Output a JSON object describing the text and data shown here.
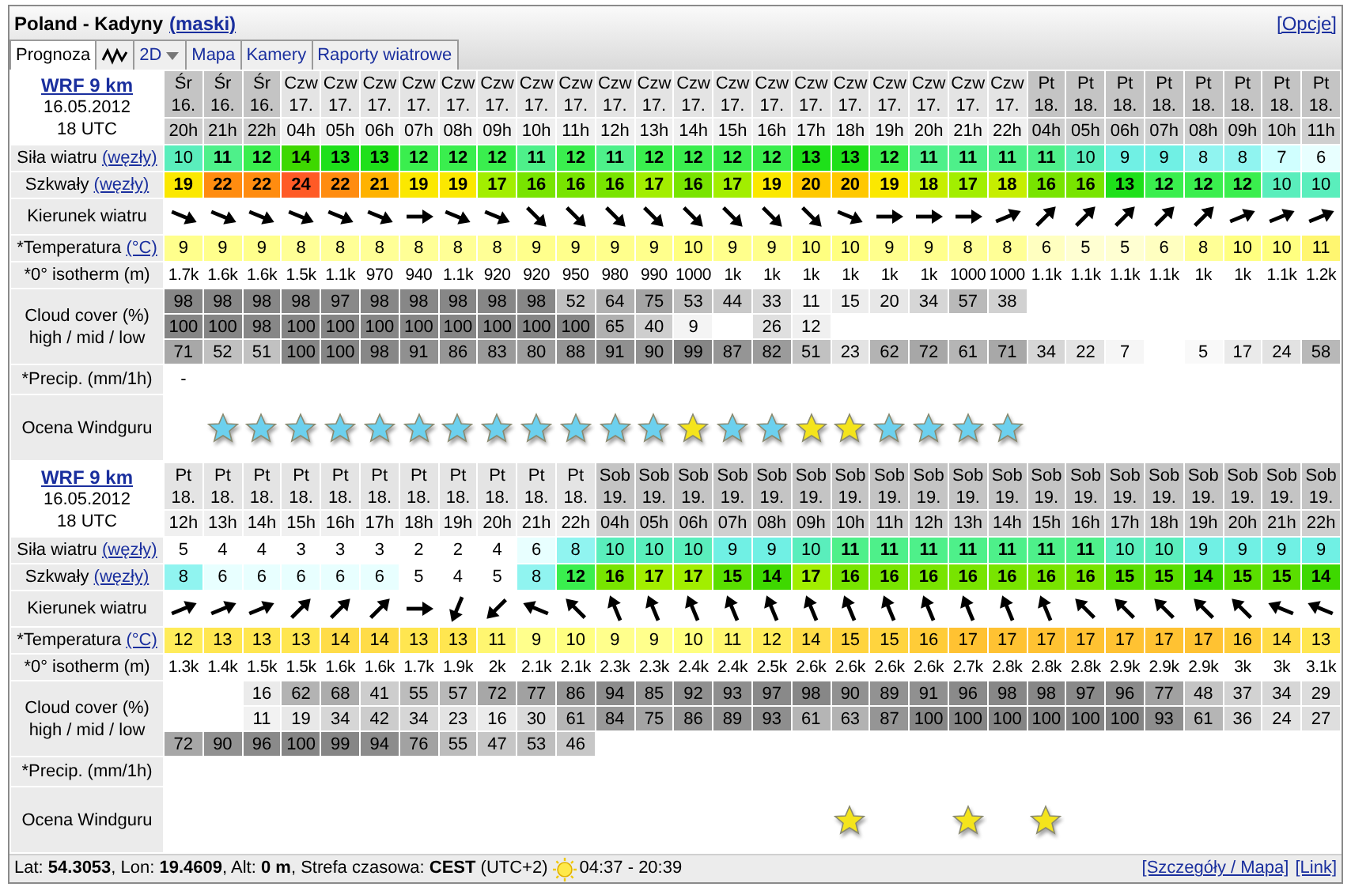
{
  "header": {
    "title": "Poland - Kadyny",
    "masks_link": "(maski)",
    "options_link": "[Opcje]"
  },
  "tabs": [
    {
      "kind": "text",
      "label": "Prognoza",
      "selected": true
    },
    {
      "kind": "graph",
      "selected": false
    },
    {
      "kind": "dropdown",
      "label": "2D",
      "selected": false
    },
    {
      "kind": "text",
      "label": "Mapa",
      "selected": false
    },
    {
      "kind": "text",
      "label": "Kamery",
      "selected": false
    },
    {
      "kind": "text",
      "label": "Raporty wiatrowe",
      "selected": false
    }
  ],
  "tables": [
    {
      "model": "WRF 9 km",
      "date": "16.05.2012",
      "run": "18 UTC",
      "labels": {
        "wind": "Siła wiatru",
        "wind_unit": "(węzły)",
        "gust": "Szkwały",
        "gust_unit": "(węzły)",
        "direction": "Kierunek wiatru",
        "temperature": "*Temperatura",
        "temperature_unit": "(°C)",
        "isotherm": "*0° isotherm (m)",
        "cloud": "Cloud cover (%)",
        "cloud_sub": "high / mid / low",
        "precip": "*Precip. (mm/1h)",
        "rating": "Ocena Windguru"
      },
      "columns": [
        {
          "day": "Śr",
          "date": "16.",
          "hour": "20h",
          "shaded": true,
          "wind": "10",
          "gust": "19",
          "direction": {
            "kind": "ese"
          },
          "temperature": "9",
          "isotherm": "1.7k",
          "cloud_high": "98",
          "cloud_mid": "100",
          "cloud_low": "71",
          "precip": "-"
        },
        {
          "day": "Śr",
          "date": "16.",
          "hour": "21h",
          "shaded": true,
          "wind": "11",
          "gust": "22",
          "direction": {
            "kind": "ese"
          },
          "temperature": "9",
          "isotherm": "1.6k",
          "cloud_high": "98",
          "cloud_mid": "100",
          "cloud_low": "52",
          "color": "#6cd0ee"
        },
        {
          "day": "Śr",
          "date": "16.",
          "hour": "22h",
          "shaded": true,
          "wind": "12",
          "gust": "22",
          "direction": {
            "kind": "ese"
          },
          "temperature": "9",
          "isotherm": "1.6k",
          "cloud_high": "98",
          "cloud_mid": "98",
          "cloud_low": "51",
          "color": "#6cd0ee"
        },
        {
          "day": "Czw",
          "date": "17.",
          "hour": "04h",
          "shaded": false,
          "wind": "14",
          "gust": "24",
          "direction": {
            "kind": "ese"
          },
          "temperature": "8",
          "isotherm": "1.5k",
          "cloud_high": "98",
          "cloud_mid": "100",
          "cloud_low": "100",
          "color": "#6cd0ee"
        },
        {
          "day": "Czw",
          "date": "17.",
          "hour": "05h",
          "shaded": false,
          "wind": "13",
          "gust": "22",
          "direction": {
            "kind": "ese"
          },
          "temperature": "8",
          "isotherm": "1.1k",
          "cloud_high": "97",
          "cloud_mid": "100",
          "cloud_low": "100",
          "color": "#6cd0ee"
        },
        {
          "day": "Czw",
          "date": "17.",
          "hour": "06h",
          "shaded": false,
          "wind": "13",
          "gust": "21",
          "direction": {
            "kind": "ese"
          },
          "temperature": "8",
          "isotherm": "970",
          "cloud_high": "98",
          "cloud_mid": "100",
          "cloud_low": "98",
          "color": "#6cd0ee"
        },
        {
          "day": "Czw",
          "date": "17.",
          "hour": "07h",
          "shaded": false,
          "wind": "12",
          "gust": "19",
          "direction": {
            "kind": "e"
          },
          "temperature": "8",
          "isotherm": "940",
          "cloud_high": "98",
          "cloud_mid": "100",
          "cloud_low": "91",
          "color": "#6cd0ee"
        },
        {
          "day": "Czw",
          "date": "17.",
          "hour": "08h",
          "shaded": false,
          "wind": "12",
          "gust": "19",
          "direction": {
            "kind": "ese"
          },
          "temperature": "8",
          "isotherm": "1.1k",
          "cloud_high": "98",
          "cloud_mid": "100",
          "cloud_low": "86",
          "color": "#6cd0ee"
        },
        {
          "day": "Czw",
          "date": "17.",
          "hour": "09h",
          "shaded": false,
          "wind": "12",
          "gust": "17",
          "direction": {
            "kind": "ese"
          },
          "temperature": "8",
          "isotherm": "920",
          "cloud_high": "98",
          "cloud_mid": "100",
          "cloud_low": "83",
          "color": "#6cd0ee"
        },
        {
          "day": "Czw",
          "date": "17.",
          "hour": "10h",
          "shaded": false,
          "wind": "11",
          "gust": "16",
          "direction": {
            "kind": "se"
          },
          "temperature": "9",
          "isotherm": "920",
          "cloud_high": "98",
          "cloud_mid": "100",
          "cloud_low": "80",
          "color": "#6cd0ee"
        },
        {
          "day": "Czw",
          "date": "17.",
          "hour": "11h",
          "shaded": false,
          "wind": "12",
          "gust": "16",
          "direction": {
            "kind": "se"
          },
          "temperature": "9",
          "isotherm": "950",
          "cloud_high": "52",
          "cloud_mid": "100",
          "cloud_low": "88",
          "color": "#6cd0ee"
        },
        {
          "day": "Czw",
          "date": "17.",
          "hour": "12h",
          "shaded": false,
          "wind": "11",
          "gust": "16",
          "direction": {
            "kind": "se"
          },
          "temperature": "9",
          "isotherm": "980",
          "cloud_high": "64",
          "cloud_mid": "65",
          "cloud_low": "91",
          "color": "#6cd0ee"
        },
        {
          "day": "Czw",
          "date": "17.",
          "hour": "13h",
          "shaded": false,
          "wind": "12",
          "gust": "17",
          "direction": {
            "kind": "se"
          },
          "temperature": "9",
          "isotherm": "990",
          "cloud_high": "75",
          "cloud_mid": "40",
          "cloud_low": "90",
          "color": "#6cd0ee"
        },
        {
          "day": "Czw",
          "date": "17.",
          "hour": "14h",
          "shaded": false,
          "wind": "12",
          "gust": "16",
          "direction": {
            "kind": "se"
          },
          "temperature": "10",
          "isotherm": "1000",
          "cloud_high": "53",
          "cloud_mid": "9",
          "cloud_low": "99",
          "color": "#f4e41c"
        },
        {
          "day": "Czw",
          "date": "17.",
          "hour": "15h",
          "shaded": false,
          "wind": "12",
          "gust": "17",
          "direction": {
            "kind": "se"
          },
          "temperature": "9",
          "isotherm": "1k",
          "cloud_high": "44",
          "cloud_low": "87",
          "color": "#6cd0ee"
        },
        {
          "day": "Czw",
          "date": "17.",
          "hour": "16h",
          "shaded": false,
          "wind": "12",
          "gust": "19",
          "direction": {
            "kind": "se"
          },
          "temperature": "9",
          "isotherm": "1k",
          "cloud_high": "33",
          "cloud_mid": "26",
          "cloud_low": "82",
          "color": "#6cd0ee"
        },
        {
          "day": "Czw",
          "date": "17.",
          "hour": "17h",
          "shaded": false,
          "wind": "13",
          "gust": "20",
          "direction": {
            "kind": "se"
          },
          "temperature": "10",
          "isotherm": "1k",
          "cloud_high": "11",
          "cloud_mid": "12",
          "cloud_low": "51",
          "color": "#f4e41c"
        },
        {
          "day": "Czw",
          "date": "17.",
          "hour": "18h",
          "shaded": false,
          "wind": "13",
          "gust": "20",
          "direction": {
            "kind": "ese"
          },
          "temperature": "10",
          "isotherm": "1k",
          "cloud_high": "15",
          "cloud_low": "23",
          "color": "#f4e41c"
        },
        {
          "day": "Czw",
          "date": "17.",
          "hour": "19h",
          "shaded": false,
          "wind": "12",
          "gust": "19",
          "direction": {
            "kind": "e"
          },
          "temperature": "9",
          "isotherm": "1k",
          "cloud_high": "20",
          "cloud_low": "62",
          "color": "#6cd0ee"
        },
        {
          "day": "Czw",
          "date": "17.",
          "hour": "20h",
          "shaded": false,
          "wind": "11",
          "gust": "18",
          "direction": {
            "kind": "e"
          },
          "temperature": "9",
          "isotherm": "1k",
          "cloud_high": "34",
          "cloud_low": "72",
          "color": "#6cd0ee"
        },
        {
          "day": "Czw",
          "date": "17.",
          "hour": "21h",
          "shaded": false,
          "wind": "11",
          "gust": "17",
          "direction": {
            "kind": "e"
          },
          "temperature": "8",
          "isotherm": "1000",
          "cloud_high": "57",
          "cloud_low": "61",
          "color": "#6cd0ee"
        },
        {
          "day": "Czw",
          "date": "17.",
          "hour": "22h",
          "shaded": false,
          "wind": "11",
          "gust": "18",
          "direction": {
            "kind": "ene"
          },
          "temperature": "8",
          "isotherm": "1000",
          "cloud_high": "38",
          "cloud_low": "71",
          "color": "#6cd0ee"
        },
        {
          "day": "Pt",
          "date": "18.",
          "hour": "04h",
          "shaded": true,
          "wind": "11",
          "gust": "16",
          "direction": {
            "kind": "ne"
          },
          "temperature": "6",
          "isotherm": "1.1k",
          "cloud_low": "34"
        },
        {
          "day": "Pt",
          "date": "18.",
          "hour": "05h",
          "shaded": true,
          "wind": "10",
          "gust": "16",
          "direction": {
            "kind": "ne"
          },
          "temperature": "5",
          "isotherm": "1.1k",
          "cloud_low": "22"
        },
        {
          "day": "Pt",
          "date": "18.",
          "hour": "06h",
          "shaded": true,
          "wind": "9",
          "gust": "13",
          "direction": {
            "kind": "ne"
          },
          "temperature": "5",
          "isotherm": "1.1k",
          "cloud_low": "7"
        },
        {
          "day": "Pt",
          "date": "18.",
          "hour": "07h",
          "shaded": true,
          "wind": "9",
          "gust": "12",
          "direction": {
            "kind": "ne"
          },
          "temperature": "6",
          "isotherm": "1.1k"
        },
        {
          "day": "Pt",
          "date": "18.",
          "hour": "08h",
          "shaded": true,
          "wind": "8",
          "gust": "12",
          "direction": {
            "kind": "ne"
          },
          "temperature": "8",
          "isotherm": "1k",
          "cloud_low": "5"
        },
        {
          "day": "Pt",
          "date": "18.",
          "hour": "09h",
          "shaded": true,
          "wind": "8",
          "gust": "12",
          "direction": {
            "kind": "ene"
          },
          "temperature": "10",
          "isotherm": "1k",
          "cloud_low": "17"
        },
        {
          "day": "Pt",
          "date": "18.",
          "hour": "10h",
          "shaded": true,
          "wind": "7",
          "gust": "10",
          "direction": {
            "kind": "ene"
          },
          "temperature": "10",
          "isotherm": "1.1k",
          "cloud_low": "24"
        },
        {
          "day": "Pt",
          "date": "18.",
          "hour": "11h",
          "shaded": true,
          "wind": "6",
          "gust": "10",
          "direction": {
            "kind": "ene"
          },
          "temperature": "11",
          "isotherm": "1.2k",
          "cloud_low": "58"
        }
      ]
    },
    {
      "model": "WRF 9 km",
      "date": "16.05.2012",
      "run": "18 UTC",
      "labels": {
        "wind": "Siła wiatru",
        "wind_unit": "(węzły)",
        "gust": "Szkwały",
        "gust_unit": "(węzły)",
        "direction": "Kierunek wiatru",
        "temperature": "*Temperatura",
        "temperature_unit": "(°C)",
        "isotherm": "*0° isotherm (m)",
        "cloud": "Cloud cover (%)",
        "cloud_sub": "high / mid / low",
        "precip": "*Precip. (mm/1h)",
        "rating": "Ocena Windguru"
      },
      "columns": [
        {
          "day": "Pt",
          "date": "18.",
          "hour": "12h",
          "shaded": false,
          "wind": "5",
          "gust": "8",
          "direction": {
            "kind": "ene"
          },
          "temperature": "12",
          "isotherm": "1.3k",
          "cloud_low": "72"
        },
        {
          "day": "Pt",
          "date": "18.",
          "hour": "13h",
          "shaded": false,
          "wind": "4",
          "gust": "6",
          "direction": {
            "kind": "ene"
          },
          "temperature": "13",
          "isotherm": "1.4k",
          "cloud_low": "90"
        },
        {
          "day": "Pt",
          "date": "18.",
          "hour": "14h",
          "shaded": false,
          "wind": "4",
          "gust": "6",
          "direction": {
            "kind": "ene"
          },
          "temperature": "13",
          "isotherm": "1.5k",
          "cloud_high": "16",
          "cloud_mid": "11",
          "cloud_low": "96"
        },
        {
          "day": "Pt",
          "date": "18.",
          "hour": "15h",
          "shaded": false,
          "wind": "3",
          "gust": "6",
          "direction": {
            "kind": "ne"
          },
          "temperature": "13",
          "isotherm": "1.5k",
          "cloud_high": "62",
          "cloud_mid": "19",
          "cloud_low": "100"
        },
        {
          "day": "Pt",
          "date": "18.",
          "hour": "16h",
          "shaded": false,
          "wind": "3",
          "gust": "6",
          "direction": {
            "kind": "ne"
          },
          "temperature": "14",
          "isotherm": "1.6k",
          "cloud_high": "68",
          "cloud_mid": "34",
          "cloud_low": "99"
        },
        {
          "day": "Pt",
          "date": "18.",
          "hour": "17h",
          "shaded": false,
          "wind": "3",
          "gust": "6",
          "direction": {
            "kind": "ne"
          },
          "temperature": "14",
          "isotherm": "1.6k",
          "cloud_high": "41",
          "cloud_mid": "42",
          "cloud_low": "94"
        },
        {
          "day": "Pt",
          "date": "18.",
          "hour": "18h",
          "shaded": false,
          "wind": "2",
          "gust": "5",
          "direction": {
            "kind": "e"
          },
          "temperature": "13",
          "isotherm": "1.7k",
          "cloud_high": "55",
          "cloud_mid": "34",
          "cloud_low": "76"
        },
        {
          "day": "Pt",
          "date": "18.",
          "hour": "19h",
          "shaded": false,
          "wind": "2",
          "gust": "4",
          "direction": {
            "kind": "ssw"
          },
          "temperature": "13",
          "isotherm": "1.9k",
          "cloud_high": "57",
          "cloud_mid": "23",
          "cloud_low": "55"
        },
        {
          "day": "Pt",
          "date": "18.",
          "hour": "20h",
          "shaded": false,
          "wind": "4",
          "gust": "5",
          "direction": {
            "kind": "sw"
          },
          "temperature": "11",
          "isotherm": "2k",
          "cloud_high": "72",
          "cloud_mid": "16",
          "cloud_low": "47"
        },
        {
          "day": "Pt",
          "date": "18.",
          "hour": "21h",
          "shaded": false,
          "wind": "6",
          "gust": "8",
          "direction": {
            "kind": "wnw"
          },
          "temperature": "9",
          "isotherm": "2.1k",
          "cloud_high": "77",
          "cloud_mid": "30",
          "cloud_low": "53"
        },
        {
          "day": "Pt",
          "date": "18.",
          "hour": "22h",
          "shaded": false,
          "wind": "8",
          "gust": "12",
          "direction": {
            "kind": "nw"
          },
          "temperature": "10",
          "isotherm": "2.1k",
          "cloud_high": "86",
          "cloud_mid": "61",
          "cloud_low": "46"
        },
        {
          "day": "Sob",
          "date": "19.",
          "hour": "04h",
          "shaded": true,
          "wind": "10",
          "gust": "16",
          "direction": {
            "kind": "nnw"
          },
          "temperature": "9",
          "isotherm": "2.3k",
          "cloud_high": "94",
          "cloud_mid": "84"
        },
        {
          "day": "Sob",
          "date": "19.",
          "hour": "05h",
          "shaded": true,
          "wind": "10",
          "gust": "17",
          "direction": {
            "kind": "nnw"
          },
          "temperature": "9",
          "isotherm": "2.3k",
          "cloud_high": "85",
          "cloud_mid": "75"
        },
        {
          "day": "Sob",
          "date": "19.",
          "hour": "06h",
          "shaded": true,
          "wind": "10",
          "gust": "17",
          "direction": {
            "kind": "nnw"
          },
          "temperature": "10",
          "isotherm": "2.4k",
          "cloud_high": "92",
          "cloud_mid": "86"
        },
        {
          "day": "Sob",
          "date": "19.",
          "hour": "07h",
          "shaded": true,
          "wind": "9",
          "gust": "15",
          "direction": {
            "kind": "nnw"
          },
          "temperature": "11",
          "isotherm": "2.4k",
          "cloud_high": "93",
          "cloud_mid": "89"
        },
        {
          "day": "Sob",
          "date": "19.",
          "hour": "08h",
          "shaded": true,
          "wind": "9",
          "gust": "14",
          "direction": {
            "kind": "nnw"
          },
          "temperature": "12",
          "isotherm": "2.5k",
          "cloud_high": "97",
          "cloud_mid": "93"
        },
        {
          "day": "Sob",
          "date": "19.",
          "hour": "09h",
          "shaded": true,
          "wind": "10",
          "gust": "17",
          "direction": {
            "kind": "nnw"
          },
          "temperature": "14",
          "isotherm": "2.6k",
          "cloud_high": "98",
          "cloud_mid": "61"
        },
        {
          "day": "Sob",
          "date": "19.",
          "hour": "10h",
          "shaded": true,
          "wind": "11",
          "gust": "16",
          "direction": {
            "kind": "nnw"
          },
          "temperature": "15",
          "isotherm": "2.6k",
          "cloud_high": "90",
          "cloud_mid": "63",
          "color": "#f4e41c"
        },
        {
          "day": "Sob",
          "date": "19.",
          "hour": "11h",
          "shaded": true,
          "wind": "11",
          "gust": "16",
          "direction": {
            "kind": "nnw"
          },
          "temperature": "15",
          "isotherm": "2.6k",
          "cloud_high": "89",
          "cloud_mid": "87"
        },
        {
          "day": "Sob",
          "date": "19.",
          "hour": "12h",
          "shaded": true,
          "wind": "11",
          "gust": "16",
          "direction": {
            "kind": "nnw"
          },
          "temperature": "16",
          "isotherm": "2.6k",
          "cloud_high": "91",
          "cloud_mid": "100"
        },
        {
          "day": "Sob",
          "date": "19.",
          "hour": "13h",
          "shaded": true,
          "wind": "11",
          "gust": "16",
          "direction": {
            "kind": "nnw"
          },
          "temperature": "17",
          "isotherm": "2.7k",
          "cloud_high": "96",
          "cloud_mid": "100",
          "color": "#f4e41c"
        },
        {
          "day": "Sob",
          "date": "19.",
          "hour": "14h",
          "shaded": true,
          "wind": "11",
          "gust": "16",
          "direction": {
            "kind": "nnw"
          },
          "temperature": "17",
          "isotherm": "2.8k",
          "cloud_high": "98",
          "cloud_mid": "100"
        },
        {
          "day": "Sob",
          "date": "19.",
          "hour": "15h",
          "shaded": true,
          "wind": "11",
          "gust": "16",
          "direction": {
            "kind": "nnw"
          },
          "temperature": "17",
          "isotherm": "2.8k",
          "cloud_high": "98",
          "cloud_mid": "100",
          "color": "#f4e41c"
        },
        {
          "day": "Sob",
          "date": "19.",
          "hour": "16h",
          "shaded": true,
          "wind": "11",
          "gust": "16",
          "direction": {
            "kind": "nw"
          },
          "temperature": "17",
          "isotherm": "2.8k",
          "cloud_high": "97",
          "cloud_mid": "100"
        },
        {
          "day": "Sob",
          "date": "19.",
          "hour": "17h",
          "shaded": true,
          "wind": "10",
          "gust": "15",
          "direction": {
            "kind": "nw"
          },
          "temperature": "17",
          "isotherm": "2.9k",
          "cloud_high": "96",
          "cloud_mid": "100"
        },
        {
          "day": "Sob",
          "date": "19.",
          "hour": "18h",
          "shaded": true,
          "wind": "10",
          "gust": "15",
          "direction": {
            "kind": "nw"
          },
          "temperature": "17",
          "isotherm": "2.9k",
          "cloud_high": "77",
          "cloud_mid": "93"
        },
        {
          "day": "Sob",
          "date": "19.",
          "hour": "19h",
          "shaded": true,
          "wind": "9",
          "gust": "14",
          "direction": {
            "kind": "nw"
          },
          "temperature": "17",
          "isotherm": "2.9k",
          "cloud_high": "48",
          "cloud_mid": "61"
        },
        {
          "day": "Sob",
          "date": "19.",
          "hour": "20h",
          "shaded": true,
          "wind": "9",
          "gust": "15",
          "direction": {
            "kind": "nw"
          },
          "temperature": "16",
          "isotherm": "3k",
          "cloud_high": "37",
          "cloud_mid": "36"
        },
        {
          "day": "Sob",
          "date": "19.",
          "hour": "21h",
          "shaded": true,
          "wind": "9",
          "gust": "15",
          "direction": {
            "kind": "wnw"
          },
          "temperature": "14",
          "isotherm": "3k",
          "cloud_high": "34",
          "cloud_mid": "24"
        },
        {
          "day": "Sob",
          "date": "19.",
          "hour": "22h",
          "shaded": true,
          "wind": "9",
          "gust": "14",
          "direction": {
            "kind": "wnw"
          },
          "temperature": "13",
          "isotherm": "3.1k",
          "cloud_high": "29",
          "cloud_mid": "27"
        }
      ]
    }
  ],
  "footer": {
    "location": "Lat: **54.3053**, Lon: **19.4609**, Alt: **0 m**, Strefa czasowa: **CEST** (UTC+2)",
    "sun_times": "04:37 - 20:39",
    "details_link": "[Szczegóły / Mapa]",
    "link": "[Link]"
  }
}
